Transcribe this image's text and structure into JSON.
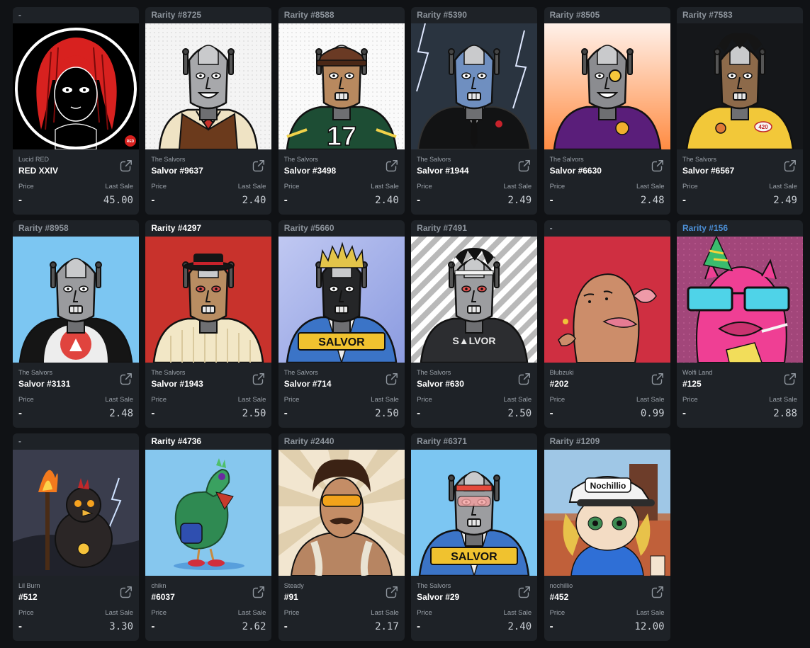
{
  "labels": {
    "price": "Price",
    "last_sale": "Last Sale"
  },
  "cards": [
    {
      "rarity": "-",
      "rarity_style": "gray",
      "collection": "Lucid RED",
      "name": "RED XXIV",
      "price": "-",
      "last_sale": "45.00",
      "art": "lucid-red"
    },
    {
      "rarity": "Rarity #8725",
      "rarity_style": "gray",
      "collection": "The Salvors",
      "name": "Salvor #9637",
      "price": "-",
      "last_sale": "2.40",
      "art": "salvor-vest"
    },
    {
      "rarity": "Rarity #8588",
      "rarity_style": "gray",
      "collection": "The Salvors",
      "name": "Salvor #3498",
      "price": "-",
      "last_sale": "2.40",
      "art": "salvor-jersey"
    },
    {
      "rarity": "Rarity #5390",
      "rarity_style": "gray",
      "collection": "The Salvors",
      "name": "Salvor #1944",
      "price": "-",
      "last_sale": "2.49",
      "art": "salvor-suit"
    },
    {
      "rarity": "Rarity #8505",
      "rarity_style": "gray",
      "collection": "The Salvors",
      "name": "Salvor #6630",
      "price": "-",
      "last_sale": "2.48",
      "art": "salvor-purple"
    },
    {
      "rarity": "Rarity #7583",
      "rarity_style": "gray",
      "collection": "The Salvors",
      "name": "Salvor #6567",
      "price": "-",
      "last_sale": "2.49",
      "art": "salvor-yellow"
    },
    {
      "rarity": "Rarity #8958",
      "rarity_style": "gray",
      "collection": "The Salvors",
      "name": "Salvor #3131",
      "price": "-",
      "last_sale": "2.48",
      "art": "salvor-avax"
    },
    {
      "rarity": "Rarity #4297",
      "rarity_style": "white",
      "collection": "The Salvors",
      "name": "Salvor #1943",
      "price": "-",
      "last_sale": "2.50",
      "art": "salvor-sweater"
    },
    {
      "rarity": "Rarity #5660",
      "rarity_style": "gray",
      "collection": "The Salvors",
      "name": "Salvor #714",
      "price": "-",
      "last_sale": "2.50",
      "art": "salvor-jacket"
    },
    {
      "rarity": "Rarity #7491",
      "rarity_style": "gray",
      "collection": "The Salvors",
      "name": "Salvor #630",
      "price": "-",
      "last_sale": "2.50",
      "art": "salvor-striped"
    },
    {
      "rarity": "-",
      "rarity_style": "gray",
      "collection": "Blubzuki",
      "name": "#202",
      "price": "-",
      "last_sale": "0.99",
      "art": "blubzuki"
    },
    {
      "rarity": "Rarity #156",
      "rarity_style": "blue",
      "collection": "Wolfi Land",
      "name": "#125",
      "price": "-",
      "last_sale": "2.88",
      "art": "wolfi"
    },
    {
      "rarity": "-",
      "rarity_style": "gray",
      "collection": "Lil Burn",
      "name": "#512",
      "price": "-",
      "last_sale": "3.30",
      "art": "lilburn"
    },
    {
      "rarity": "Rarity #4736",
      "rarity_style": "white",
      "collection": "chikn",
      "name": "#6037",
      "price": "-",
      "last_sale": "2.62",
      "art": "chikn"
    },
    {
      "rarity": "Rarity #2440",
      "rarity_style": "gray",
      "collection": "Steady",
      "name": "#91",
      "price": "-",
      "last_sale": "2.17",
      "art": "steady"
    },
    {
      "rarity": "Rarity #6371",
      "rarity_style": "gray",
      "collection": "The Salvors",
      "name": "Salvor #29",
      "price": "-",
      "last_sale": "2.40",
      "art": "salvor-29"
    },
    {
      "rarity": "Rarity #1209",
      "rarity_style": "gray",
      "collection": "nochillio",
      "name": "#452",
      "price": "-",
      "last_sale": "12.00",
      "art": "nochillio"
    }
  ],
  "art_text": {
    "red_badge": "RED",
    "jersey_number": "17",
    "badge_420": "420",
    "jacket_text": "SALVOR",
    "striped_text": "S▲LVOR",
    "cap_text": "Nochillio"
  }
}
